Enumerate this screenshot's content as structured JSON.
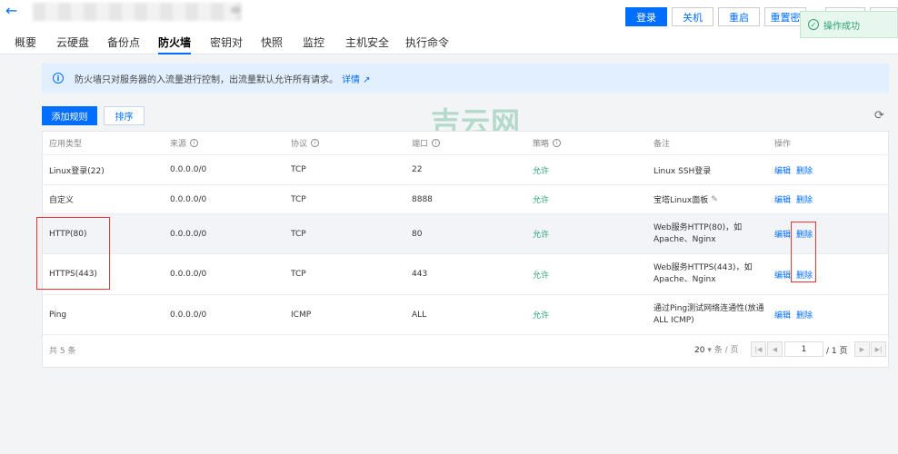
{
  "header": {
    "title_suffix": "ıɒ",
    "buttons": [
      "登录",
      "关机",
      "重启",
      "重置密"
    ],
    "tabs": [
      "概要",
      "云硬盘",
      "备份点",
      "防火墙",
      "密钥对",
      "快照",
      "监控",
      "主机安全",
      "执行命令"
    ],
    "active_tab": "防火墙"
  },
  "toast": {
    "text": "操作成功"
  },
  "notice": {
    "text": "防火墙只对服务器的入流量进行控制，出流量默认允许所有请求。",
    "link": "详情"
  },
  "toolbar": {
    "add_label": "添加规则",
    "sort_label": "排序"
  },
  "watermark": "吉云网",
  "table": {
    "columns": [
      "应用类型",
      "来源",
      "协议",
      "端口",
      "策略",
      "备注",
      "操作"
    ],
    "rows": [
      {
        "app": "Linux登录(22)",
        "source": "0.0.0.0/0",
        "protocol": "TCP",
        "port": "22",
        "policy": "允许",
        "note": "Linux SSH登录",
        "note2": ""
      },
      {
        "app": "自定义",
        "source": "0.0.0.0/0",
        "protocol": "TCP",
        "port": "8888",
        "policy": "允许",
        "note": "宝塔Linux面板",
        "note2": ""
      },
      {
        "app": "HTTP(80)",
        "source": "0.0.0.0/0",
        "protocol": "TCP",
        "port": "80",
        "policy": "允许",
        "note": "Web服务HTTP(80)，如",
        "note2": "Apache、Nginx"
      },
      {
        "app": "HTTPS(443)",
        "source": "0.0.0.0/0",
        "protocol": "TCP",
        "port": "443",
        "policy": "允许",
        "note": "Web服务HTTPS(443)，如",
        "note2": "Apache、Nginx"
      },
      {
        "app": "Ping",
        "source": "0.0.0.0/0",
        "protocol": "ICMP",
        "port": "ALL",
        "policy": "允许",
        "note": "通过Ping测试网络连通性(放通",
        "note2": "ALL ICMP)"
      }
    ],
    "edit_label": "编辑",
    "delete_label": "删除",
    "total": "共 5 条"
  },
  "pager": {
    "page_size": "20",
    "per_page": "条 / 页",
    "current": "1",
    "total_pages": "/ 1 页"
  },
  "colors": {
    "accent": "#006eff",
    "allow": "#2ba471",
    "highlight_box": "#ee3333"
  }
}
